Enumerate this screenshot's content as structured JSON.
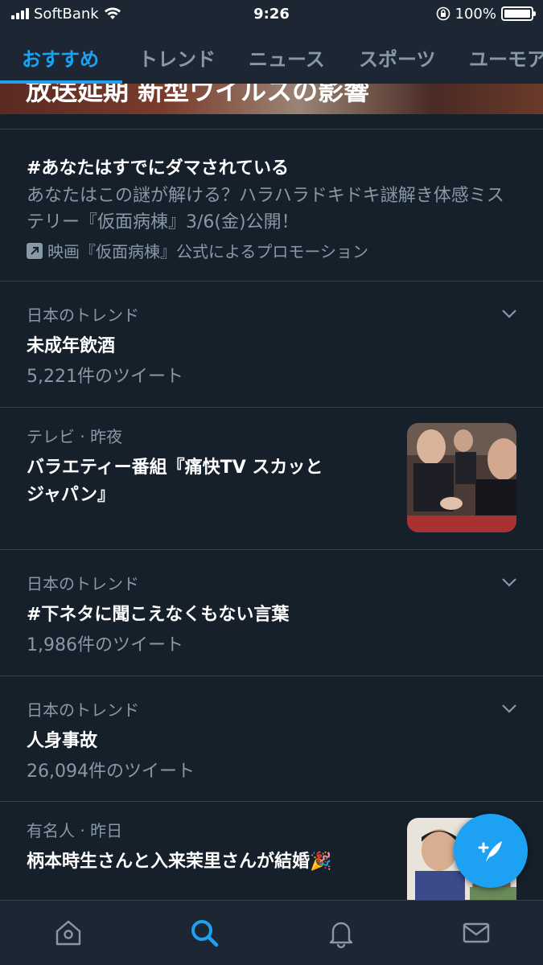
{
  "status_bar": {
    "carrier": "SoftBank",
    "time": "9:26",
    "battery": "100%",
    "battery_level": 1.0
  },
  "tabs": [
    {
      "label": "おすすめ",
      "active": true
    },
    {
      "label": "トレンド",
      "active": false
    },
    {
      "label": "ニュース",
      "active": false
    },
    {
      "label": "スポーツ",
      "active": false
    },
    {
      "label": "ユーモア",
      "active": false
    }
  ],
  "banner": {
    "text": "放送延期 新型ウイルスの影響"
  },
  "promoted": {
    "title": "#あなたはすでにダマされている",
    "description": "あなたはこの謎が解ける？ハラハラドキドキ謎解き体感ミステリー『仮面病棟』3/6(金)公開！",
    "promo_label": "映画『仮面病棟』公式によるプロモーション"
  },
  "trends": [
    {
      "meta": "日本のトレンド",
      "title": "未成年飲酒",
      "count": "5,221件のツイート"
    },
    {
      "meta": "テレビ · 昨夜",
      "title_line1": "バラエティー番組『痛快TV スカッと",
      "title_line2": "ジャパン』"
    },
    {
      "meta": "日本のトレンド",
      "title": "#下ネタに聞こえなくもない言葉",
      "count": "1,986件のツイート"
    },
    {
      "meta": "日本のトレンド",
      "title": "人身事故",
      "count": "26,094件のツイート"
    },
    {
      "meta": "有名人 · 昨日",
      "title": "柄本時生さんと入来茉里さんが結婚🎉"
    }
  ],
  "colors": {
    "background": "#15202b",
    "accent": "#1da1f2",
    "secondary_text": "#8899a6",
    "divider": "#38444d"
  },
  "icons": {
    "fab": "compose-tweet-icon",
    "nav": [
      "home-icon",
      "search-icon",
      "notifications-icon",
      "messages-icon"
    ]
  }
}
